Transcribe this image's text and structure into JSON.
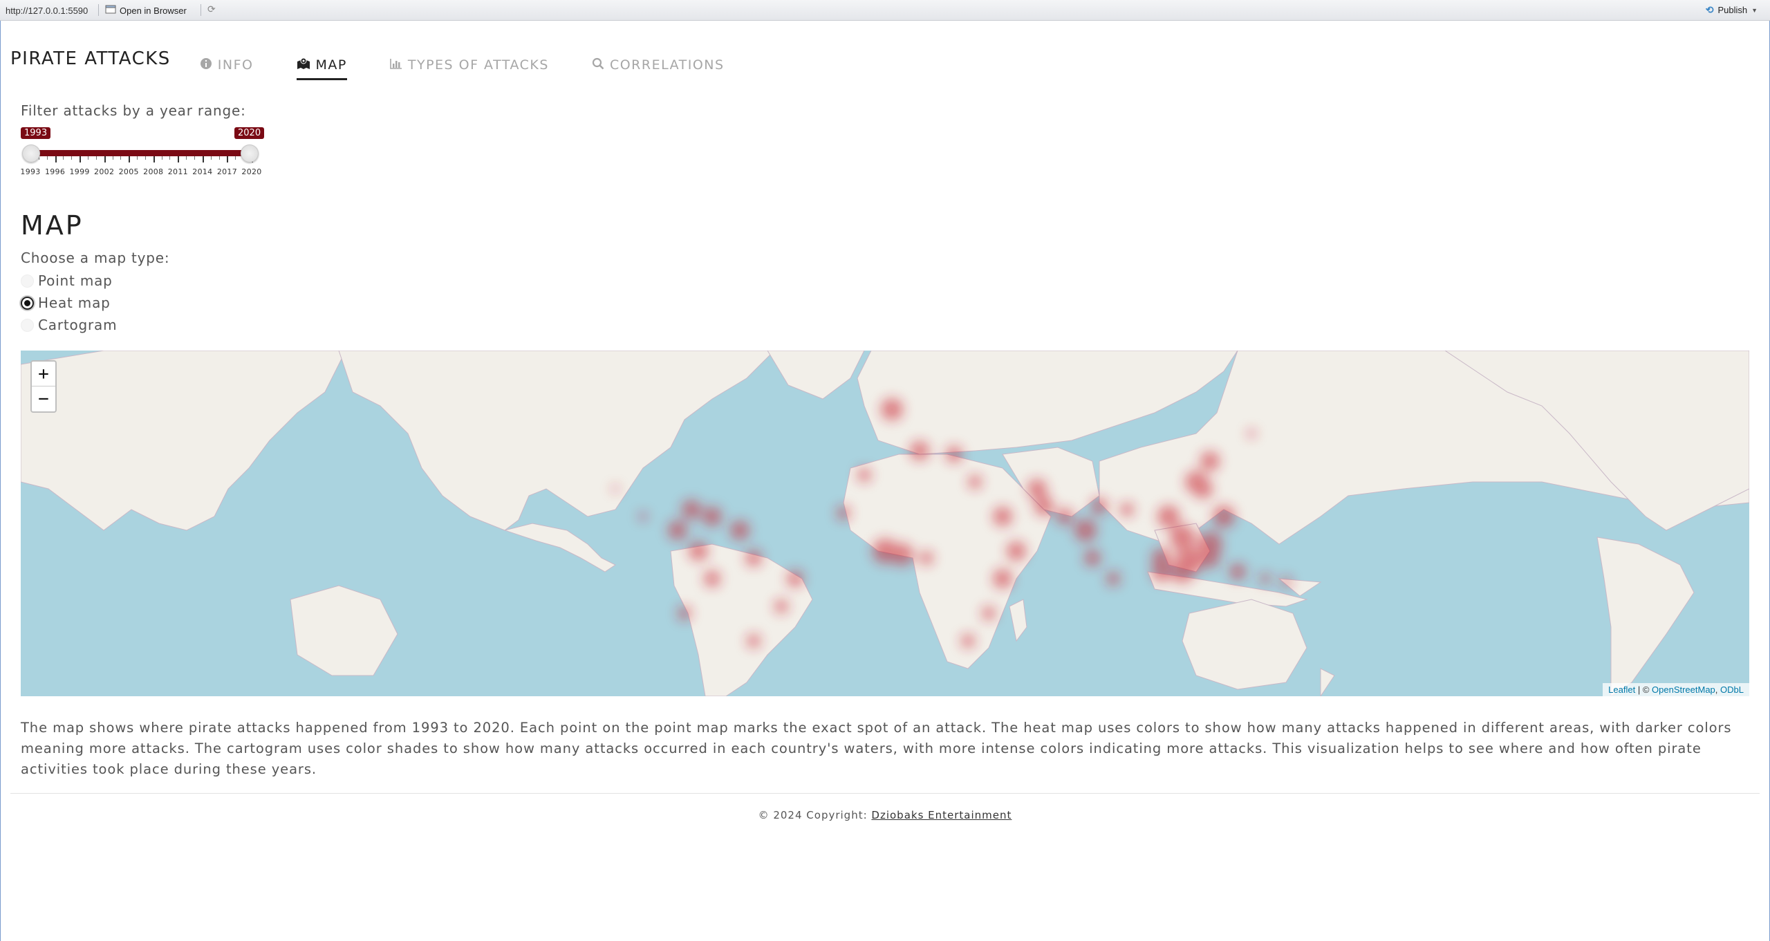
{
  "viewer": {
    "url": "http://127.0.0.1:5590",
    "open_in_browser": "Open in Browser",
    "publish": "Publish"
  },
  "nav": {
    "brand": "PIRATE ATTACKS",
    "tabs": [
      {
        "label": "INFO",
        "icon": "info-circle-icon"
      },
      {
        "label": "MAP",
        "icon": "map-icon",
        "active": true
      },
      {
        "label": "TYPES OF ATTACKS",
        "icon": "bar-chart-icon"
      },
      {
        "label": "CORRELATIONS",
        "icon": "search-icon"
      }
    ]
  },
  "filter": {
    "label": "Filter attacks by a year range:",
    "min": 1993,
    "max": 2020,
    "from": "1993",
    "to": "2020",
    "tick_labels": [
      "1993",
      "1996",
      "1999",
      "2002",
      "2005",
      "2008",
      "2011",
      "2014",
      "2017",
      "2020"
    ]
  },
  "map_section": {
    "title": "MAP",
    "choose_label": "Choose a map type:",
    "options": [
      {
        "label": "Point map",
        "checked": false
      },
      {
        "label": "Heat map",
        "checked": true
      },
      {
        "label": "Cartogram",
        "checked": false
      }
    ],
    "zoom_in": "+",
    "zoom_out": "−",
    "attribution": {
      "leaflet": "Leaflet",
      "separator": " | © ",
      "osm": "OpenStreetMap",
      "comma": ", ",
      "odbl": "ODbL"
    },
    "colors": {
      "water": "#aad3df",
      "land": "#f2efe9",
      "heat": "#c81e2c"
    }
  },
  "description": "The map shows where pirate attacks happened from 1993 to 2020. Each point on the point map marks the exact spot of an attack. The heat map uses colors to show how many attacks happened in different areas, with darker colors meaning more attacks. The cartogram uses color shades to show how many attacks occurred in each country's waters, with more intense colors indicating more attacks. This visualization helps to see where and how often pirate activities took place during these years.",
  "footer": {
    "prefix": "© 2024 Copyright: ",
    "link": "Dziobaks Entertainment"
  }
}
